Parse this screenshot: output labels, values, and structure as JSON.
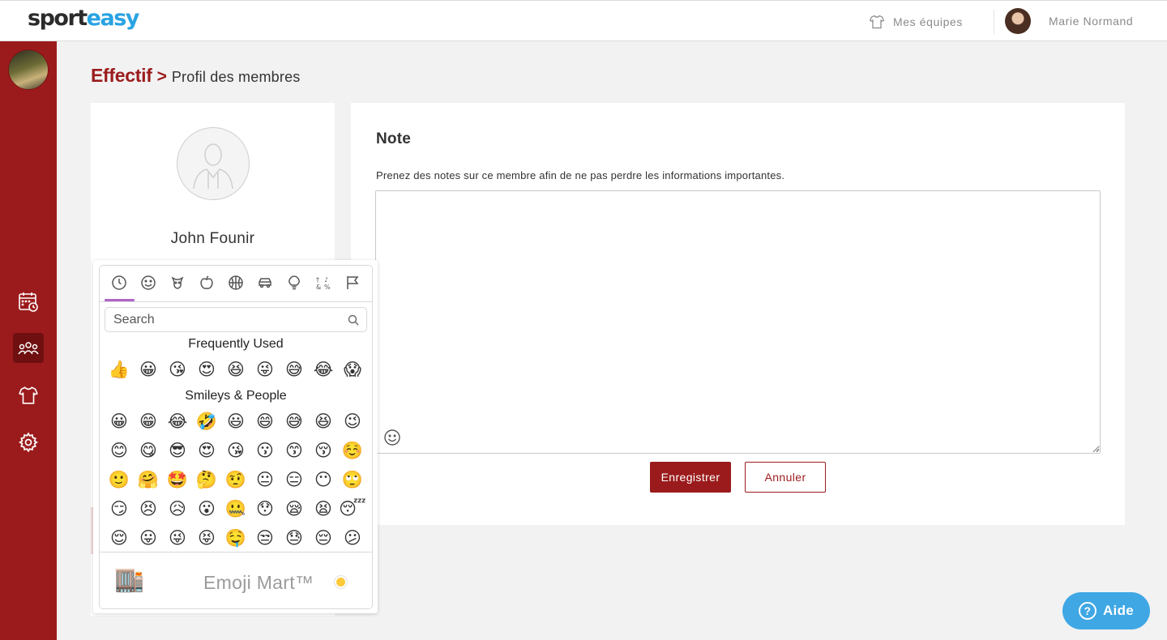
{
  "header": {
    "logo_part1": "sport",
    "logo_part2": "easy",
    "teams_label": "Mes équipes",
    "user_name": "Marie Normand"
  },
  "sidebar": {
    "items": [
      {
        "icon": "calendar-icon",
        "active": false
      },
      {
        "icon": "team-members-icon",
        "active": true
      },
      {
        "icon": "jersey-icon",
        "active": false
      },
      {
        "icon": "gear-icon",
        "active": false
      }
    ]
  },
  "breadcrumb": {
    "main": "Effectif",
    "separator": ">",
    "current": "Profil des membres"
  },
  "profile": {
    "name": "John Founir"
  },
  "note": {
    "title": "Note",
    "description": "Prenez des notes sur ce membre afin de ne pas perdre les informations importantes.",
    "value": "",
    "save_label": "Enregistrer",
    "cancel_label": "Annuler"
  },
  "emoji_picker": {
    "categories": [
      "recent-clock-icon",
      "smiley-icon",
      "animal-icon",
      "food-apple-icon",
      "sport-ball-icon",
      "car-icon",
      "lightbulb-icon",
      "symbols-icon",
      "flag-icon"
    ],
    "search_placeholder": "Search",
    "frequent_label": "Frequently Used",
    "frequent": [
      "👍",
      "😀",
      "😘",
      "😍",
      "😆",
      "😜",
      "😅",
      "😂",
      "😱"
    ],
    "smileys_label": "Smileys & People",
    "smileys": [
      "😀",
      "😁",
      "😂",
      "🤣",
      "😃",
      "😄",
      "😅",
      "😆",
      "😉",
      "😊",
      "😋",
      "😎",
      "😍",
      "😘",
      "😗",
      "😙",
      "😚",
      "☺️",
      "🙂",
      "🤗",
      "🤩",
      "🤔",
      "🤨",
      "😐",
      "😑",
      "😶",
      "🙄",
      "😏",
      "😣",
      "😥",
      "😮",
      "🤐",
      "😯",
      "😪",
      "😫",
      "😴",
      "😌",
      "😛",
      "😜",
      "😝",
      "🤤",
      "😒",
      "😓",
      "😔",
      "😕"
    ],
    "preview_emoji": "🏬",
    "brand": "Emoji Mart™",
    "skin_tone_color": "#ffc93a"
  },
  "help": {
    "label": "Aide"
  },
  "colors": {
    "brand_red": "#9b1b1c",
    "accent_blue": "#29a3e2",
    "help_blue": "#3fa7e4",
    "picker_accent": "#ae65c5"
  }
}
